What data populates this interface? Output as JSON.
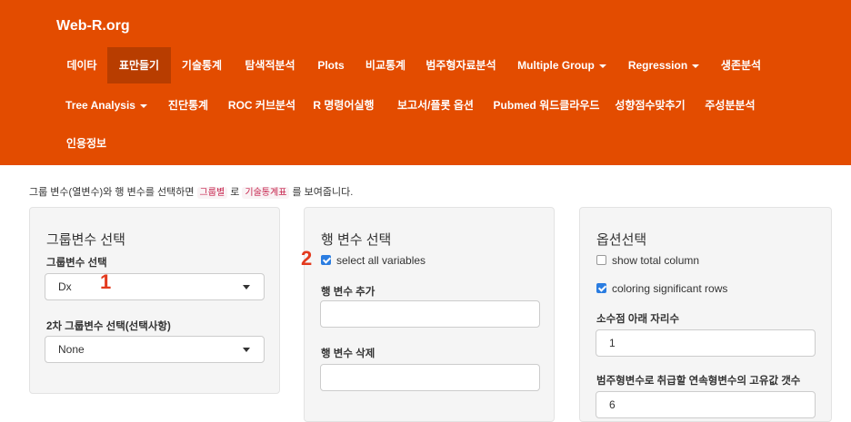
{
  "navbar": {
    "brand": "Web-R.org",
    "row1": [
      "데이타",
      "표만들기",
      "기술통계",
      "탐색적분석",
      "Plots",
      "비교통계",
      "범주형자료분석",
      "Multiple Group",
      "Regression",
      "생존분석"
    ],
    "row2": [
      "Tree Analysis",
      "진단통계",
      "ROC 커브분석",
      "R 명령어실행",
      "보고서/플롯 옵션",
      "Pubmed 워드클라우드",
      "성향점수맞추기",
      "주성분분석"
    ],
    "row3": [
      "인용정보"
    ],
    "active": "표만들기",
    "accent": "#e34c00"
  },
  "intro": {
    "before": "그룹 변수(열변수)와 행 변수를 선택하면",
    "code1": "그룹별",
    "middle": "로",
    "code2": "기술통계표",
    "after": "를 보여줍니다."
  },
  "group_panel": {
    "title": "그룹변수 선택",
    "label1": "그룹변수 선택",
    "select1": "Dx",
    "label2": "2차 그룹변수 선택(선택사항)",
    "select2": "None"
  },
  "row_panel": {
    "title": "행 변수 선택",
    "select_all": "select all variables",
    "select_all_checked": true,
    "add_label": "행 변수 추가",
    "add_value": "",
    "remove_label": "행 변수 삭제",
    "remove_value": ""
  },
  "option_panel": {
    "title": "옵션선택",
    "total_column": "show total column",
    "total_column_checked": false,
    "coloring": "coloring significant rows",
    "coloring_checked": true,
    "decimal_label": "소수점 아래 자리수",
    "decimal_value": "1",
    "unique_label": "범주형변수로 취급할 연속형변수의 고유값 갯수",
    "unique_value": "6"
  },
  "annotations": [
    "1",
    "2"
  ]
}
